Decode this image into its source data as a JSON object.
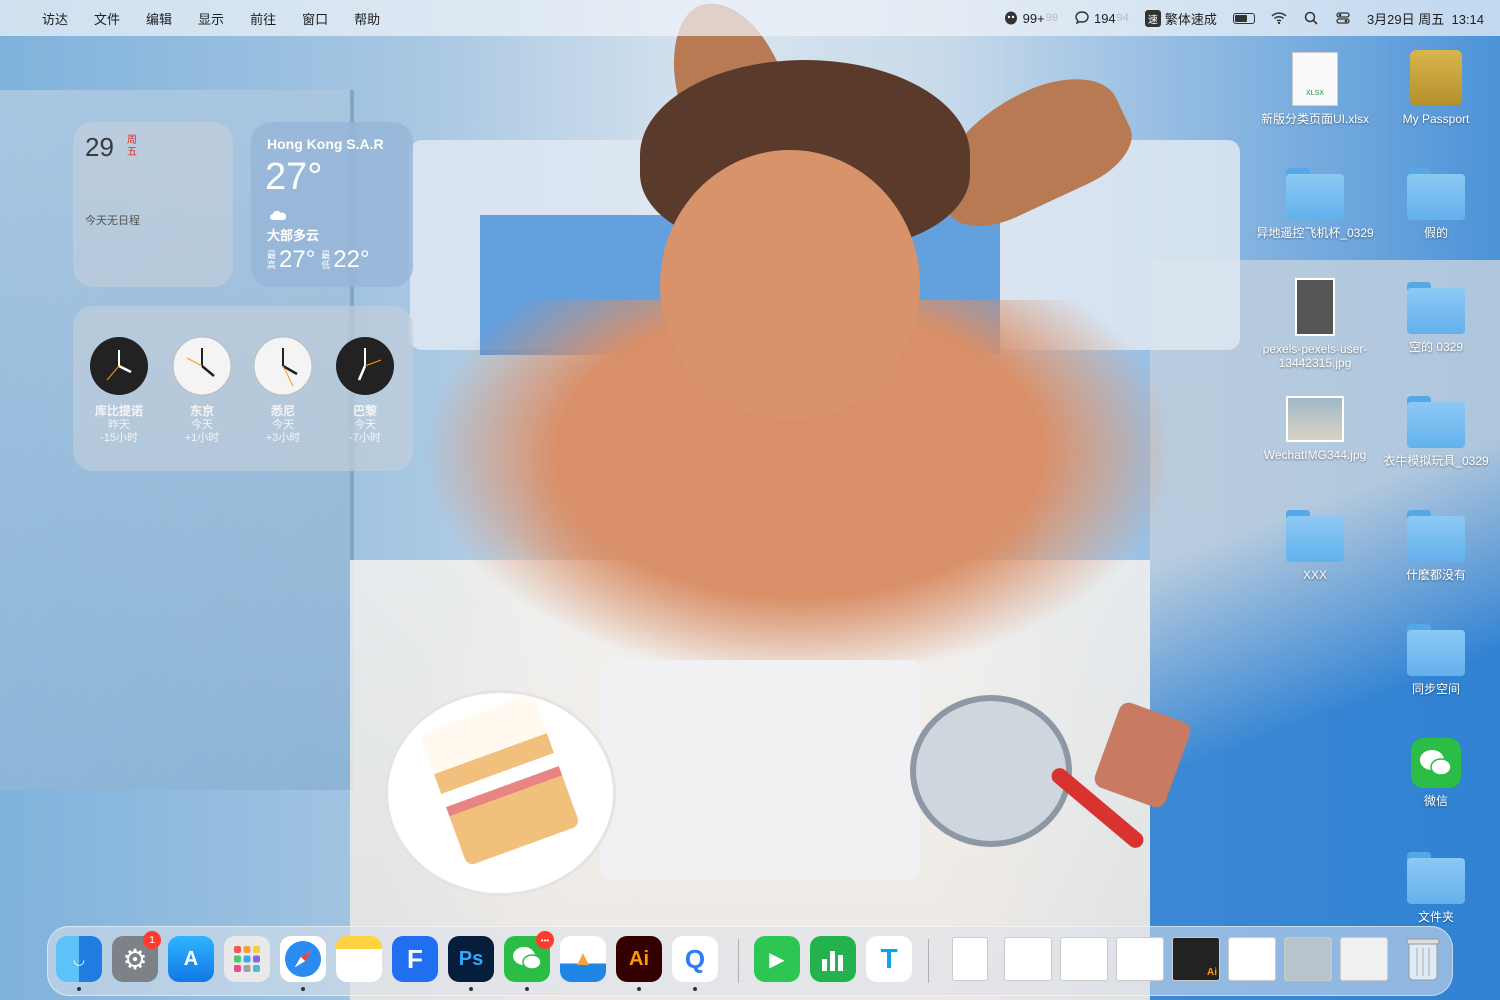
{
  "menubar": {
    "app_name": "访达",
    "menus": [
      "文件",
      "编辑",
      "显示",
      "前往",
      "窗口",
      "帮助"
    ],
    "status": {
      "qq_count": "99+",
      "qq_ghost": "99",
      "message_count": "194",
      "message_ghost": "94",
      "speed_badge": "速",
      "input_method": "繁体速成",
      "datetime": "3月29日 周五  13:14"
    }
  },
  "widgets": {
    "calendar": {
      "day": "29",
      "weekday": "周五",
      "empty": "今天无日程"
    },
    "weather": {
      "city": "Hong Kong S.A.R",
      "temp": "27°",
      "condition": "大部多云",
      "high_label": "最高",
      "high": "27°",
      "low_label": "最低",
      "low": "22°"
    },
    "clocks": [
      {
        "city": "库比提诺",
        "day": "昨天",
        "offset": "-15小时"
      },
      {
        "city": "东京",
        "day": "今天",
        "offset": "+1小时"
      },
      {
        "city": "悉尼",
        "day": "今天",
        "offset": "+3小时"
      },
      {
        "city": "巴黎",
        "day": "今天",
        "offset": "-7小时"
      }
    ]
  },
  "desktop_icons": [
    {
      "label": "新版分类页面UI.xlsx",
      "file_tag": "XLSX"
    },
    {
      "label": "My Passport"
    },
    {
      "label": "异地遥控飞机杯_0329"
    },
    {
      "label": "假的"
    },
    {
      "label": "pexels-pexels-user-13442315.jpg"
    },
    {
      "label": "空的 0329"
    },
    {
      "label": "WechatIMG344.jpg"
    },
    {
      "label": "衣牛模拟玩具_0329"
    },
    {
      "label": "XXX"
    },
    {
      "label": "什麽都没有"
    },
    {
      "label": "同步空间"
    },
    {
      "label": "微信"
    },
    {
      "label": "文件夹"
    }
  ],
  "dock": {
    "apps": [
      {
        "name": "Finder",
        "glyph": ""
      },
      {
        "name": "System Settings",
        "glyph": "⚙",
        "badge": "1"
      },
      {
        "name": "App Store",
        "glyph": "A"
      },
      {
        "name": "Launchpad",
        "glyph": ""
      },
      {
        "name": "Safari",
        "glyph": "✦"
      },
      {
        "name": "Notes",
        "glyph": ""
      },
      {
        "name": "Feishu",
        "glyph": "F"
      },
      {
        "name": "Photoshop",
        "glyph": "Ps"
      },
      {
        "name": "WeChat",
        "glyph": "",
        "badge": "•••"
      },
      {
        "name": "Keynote",
        "glyph": "▲"
      },
      {
        "name": "Illustrator",
        "glyph": "Ai"
      },
      {
        "name": "QQ Meeting",
        "glyph": "Q"
      },
      {
        "name": "FaceTime",
        "glyph": "▶"
      },
      {
        "name": "Numbers",
        "glyph": "▮"
      },
      {
        "name": "TapTap",
        "glyph": "T"
      }
    ],
    "minimized_tags": [
      "",
      "",
      "",
      "",
      "Ai",
      "",
      "",
      ""
    ]
  },
  "colors": {
    "menubar_bg": "#eef2f8",
    "badge_red": "#ff3b30",
    "folder_blue": "#63b1ec",
    "weather_widget": "#96b4d7"
  }
}
